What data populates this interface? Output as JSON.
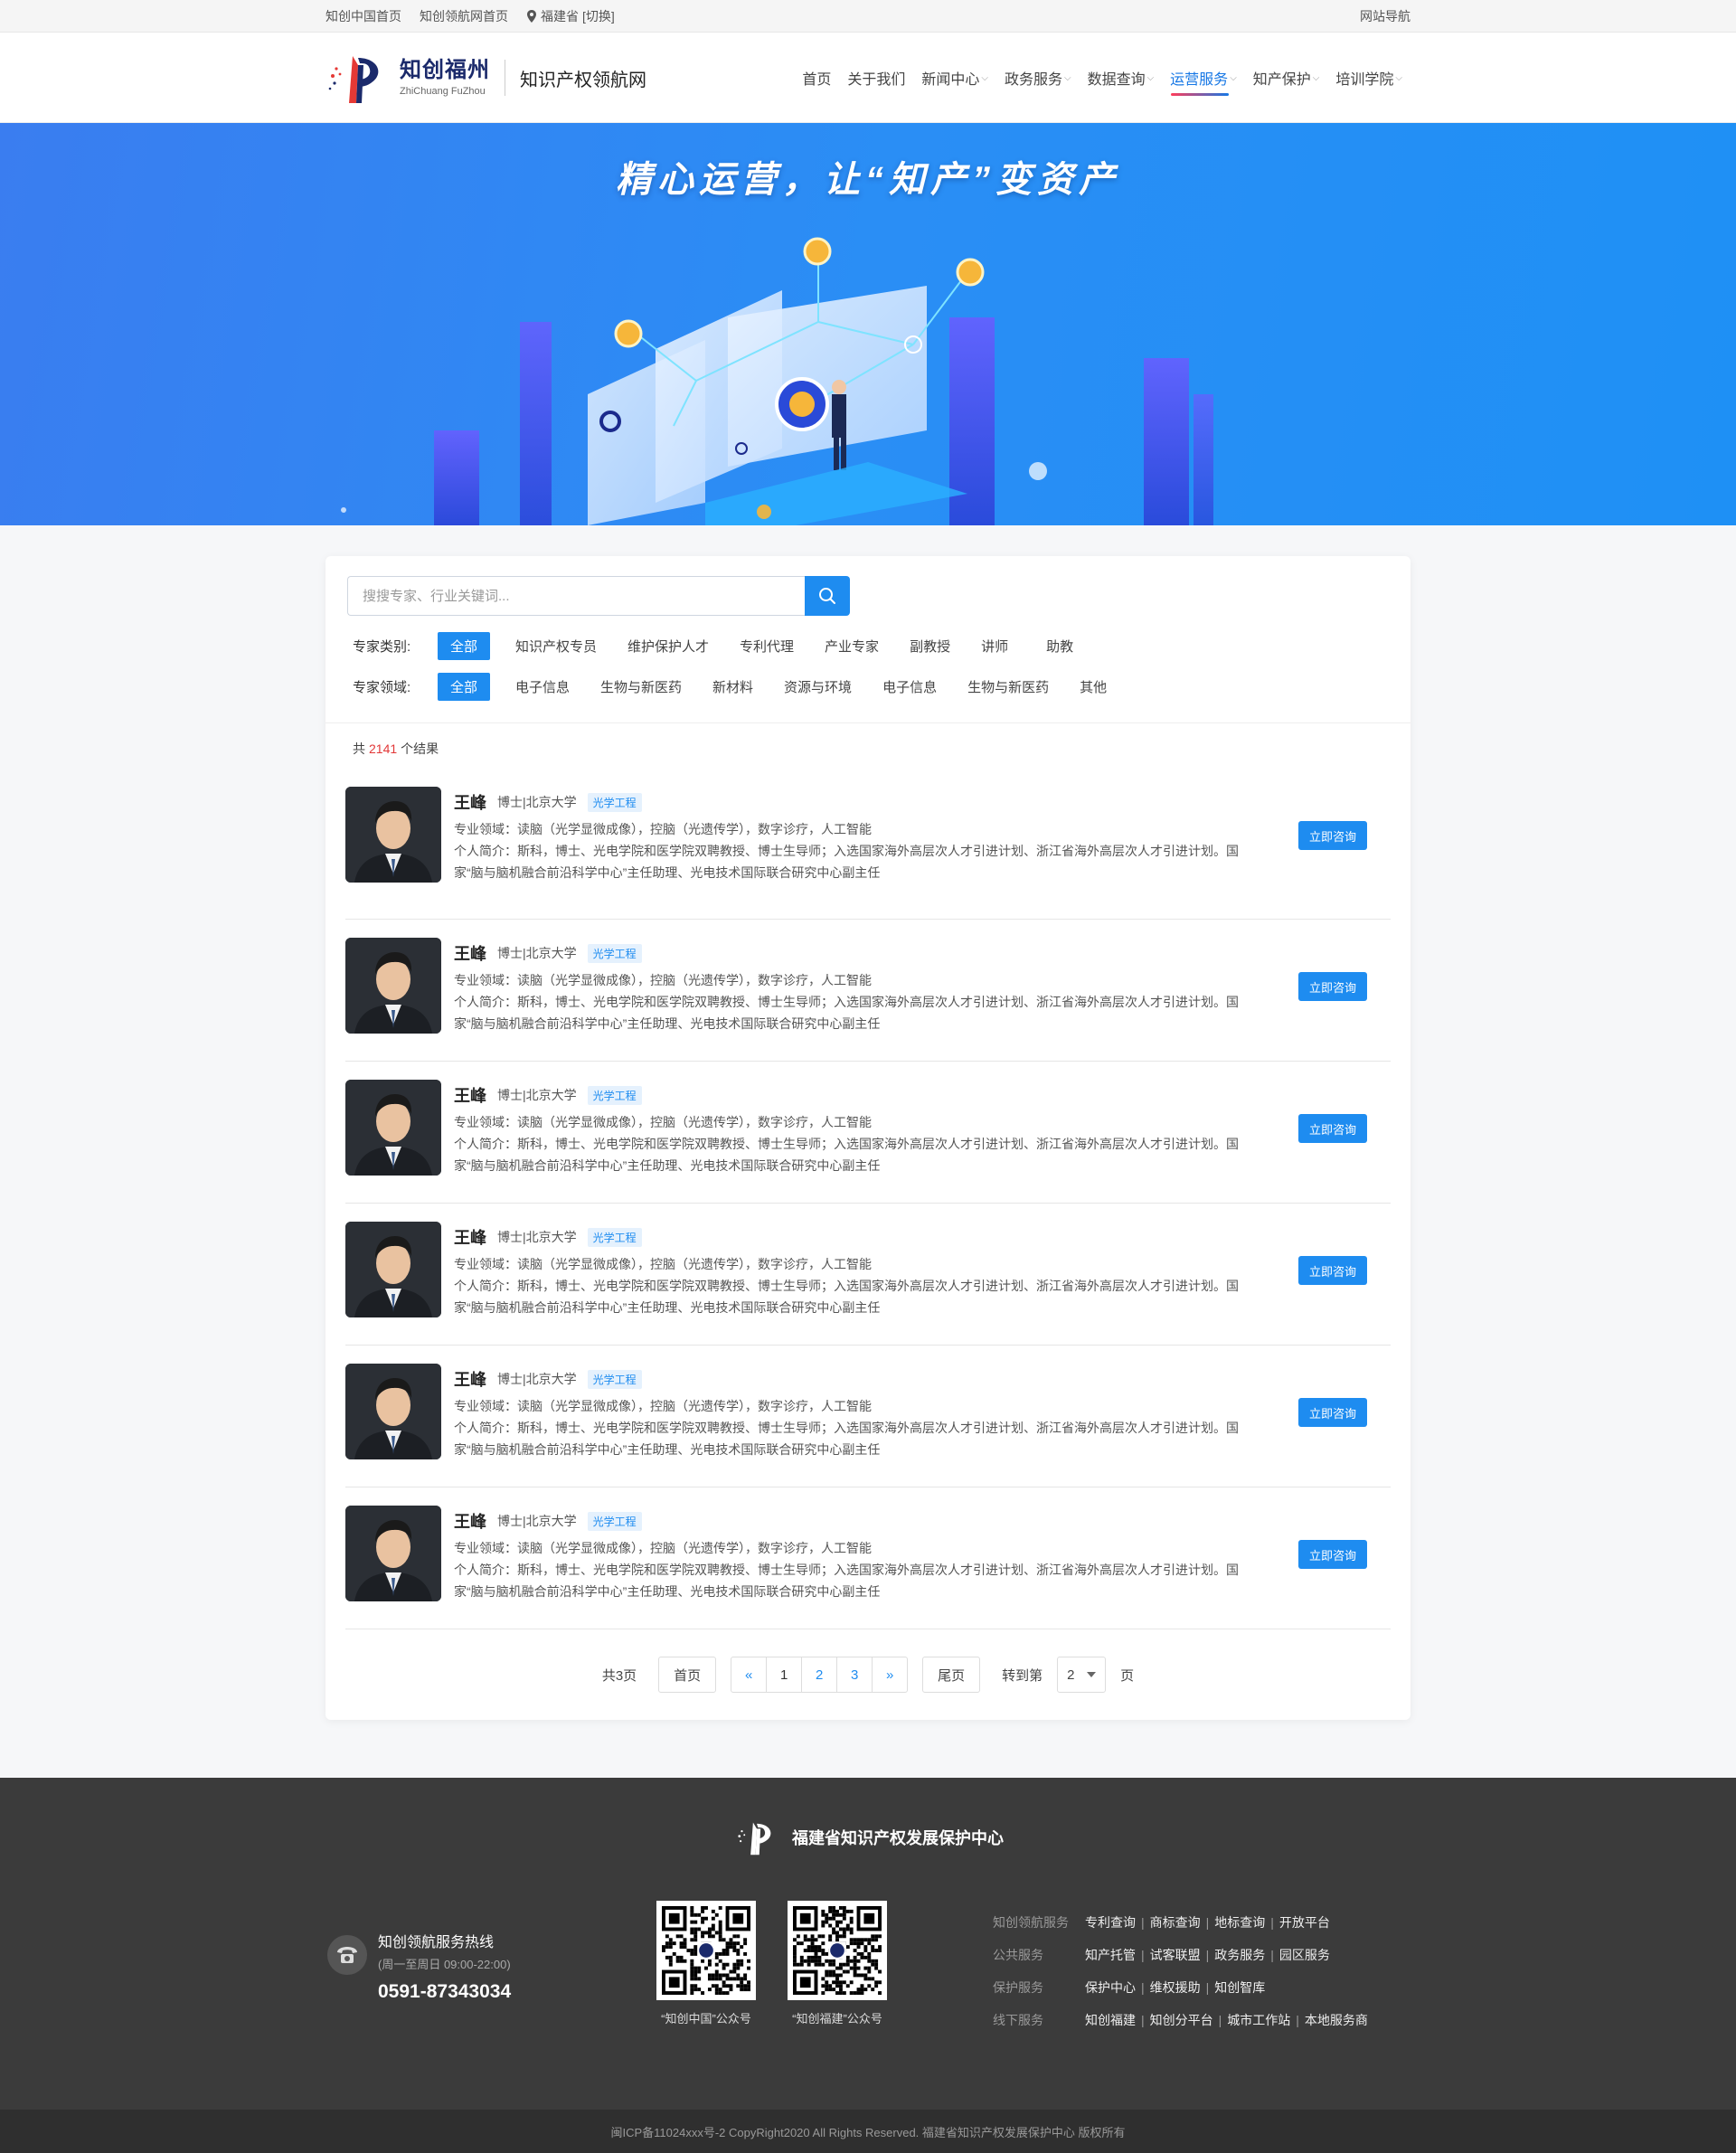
{
  "topbar": {
    "links": [
      "知创中国首页",
      "知创领航网首页"
    ],
    "location": "福建省",
    "switch_label": "[切换]",
    "site_nav": "网站导航"
  },
  "header": {
    "logo_cn": "知创福州",
    "logo_en": "ZhiChuang FuZhou",
    "site_name": "知识产权领航网",
    "nav": [
      {
        "label": "首页",
        "dropdown": false
      },
      {
        "label": "关于我们",
        "dropdown": false
      },
      {
        "label": "新闻中心",
        "dropdown": true
      },
      {
        "label": "政务服务",
        "dropdown": true
      },
      {
        "label": "数据查询",
        "dropdown": true
      },
      {
        "label": "运营服务",
        "dropdown": true,
        "active": true
      },
      {
        "label": "知产保护",
        "dropdown": true
      },
      {
        "label": "培训学院",
        "dropdown": true
      }
    ]
  },
  "banner": {
    "title": "精心运营，让“知产”变资产"
  },
  "search": {
    "placeholder": "搜搜专家、行业关键词..."
  },
  "filters": {
    "category": {
      "label": "专家类别:",
      "options": [
        "全部",
        "知识产权专员",
        "维护保护人才",
        "专利代理",
        "产业专家",
        "副教授",
        "讲师",
        "助教"
      ]
    },
    "field": {
      "label": "专家领域:",
      "options": [
        "全部",
        "电子信息",
        "生物与新医药",
        "新材料",
        "资源与环境",
        "电子信息",
        "生物与新医药",
        "其他"
      ]
    }
  },
  "results": {
    "prefix": "共",
    "count": "2141",
    "suffix": "个结果"
  },
  "experts": [
    {
      "name": "王峰",
      "degree": "博士|北京大学",
      "tag": "光学工程",
      "field": "专业领域：读脑（光学显微成像），控脑（光遗传学），数字诊疗，人工智能",
      "bio1": "个人简介：斯科，博士、光电学院和医学院双聘教授、博士生导师；入选国家海外高层次人才引进计划、浙江省海外高层次人才引进计划。国",
      "bio2": "家“脑与脑机融合前沿科学中心”主任助理、光电技术国际联合研究中心副主任",
      "button": "立即咨询"
    },
    {
      "name": "王峰",
      "degree": "博士|北京大学",
      "tag": "光学工程",
      "field": "专业领域：读脑（光学显微成像），控脑（光遗传学），数字诊疗，人工智能",
      "bio1": "个人简介：斯科，博士、光电学院和医学院双聘教授、博士生导师；入选国家海外高层次人才引进计划、浙江省海外高层次人才引进计划。国",
      "bio2": "家“脑与脑机融合前沿科学中心”主任助理、光电技术国际联合研究中心副主任",
      "button": "立即咨询"
    },
    {
      "name": "王峰",
      "degree": "博士|北京大学",
      "tag": "光学工程",
      "field": "专业领域：读脑（光学显微成像），控脑（光遗传学），数字诊疗，人工智能",
      "bio1": "个人简介：斯科，博士、光电学院和医学院双聘教授、博士生导师；入选国家海外高层次人才引进计划、浙江省海外高层次人才引进计划。国",
      "bio2": "家“脑与脑机融合前沿科学中心”主任助理、光电技术国际联合研究中心副主任",
      "button": "立即咨询"
    },
    {
      "name": "王峰",
      "degree": "博士|北京大学",
      "tag": "光学工程",
      "field": "专业领域：读脑（光学显微成像），控脑（光遗传学），数字诊疗，人工智能",
      "bio1": "个人简介：斯科，博士、光电学院和医学院双聘教授、博士生导师；入选国家海外高层次人才引进计划、浙江省海外高层次人才引进计划。国",
      "bio2": "家“脑与脑机融合前沿科学中心”主任助理、光电技术国际联合研究中心副主任",
      "button": "立即咨询"
    },
    {
      "name": "王峰",
      "degree": "博士|北京大学",
      "tag": "光学工程",
      "field": "专业领域：读脑（光学显微成像），控脑（光遗传学），数字诊疗，人工智能",
      "bio1": "个人简介：斯科，博士、光电学院和医学院双聘教授、博士生导师；入选国家海外高层次人才引进计划、浙江省海外高层次人才引进计划。国",
      "bio2": "家“脑与脑机融合前沿科学中心”主任助理、光电技术国际联合研究中心副主任",
      "button": "立即咨询"
    },
    {
      "name": "王峰",
      "degree": "博士|北京大学",
      "tag": "光学工程",
      "field": "专业领域：读脑（光学显微成像），控脑（光遗传学），数字诊疗，人工智能",
      "bio1": "个人简介：斯科，博士、光电学院和医学院双聘教授、博士生导师；入选国家海外高层次人才引进计划、浙江省海外高层次人才引进计划。国",
      "bio2": "家“脑与脑机融合前沿科学中心”主任助理、光电技术国际联合研究中心副主任",
      "button": "立即咨询"
    }
  ],
  "pagination": {
    "total_pages": "共3页",
    "first": "首页",
    "prev": "«",
    "pages": [
      "1",
      "2",
      "3"
    ],
    "current": "1",
    "next": "»",
    "last": "尾页",
    "goto_prefix": "转到第",
    "goto_value": "2",
    "goto_suffix": "页"
  },
  "footer": {
    "org": "福建省知识产权发展保护中心",
    "hotline_title": "知创领航服务热线",
    "hotline_hours": "(周一至周日 09:00-22:00)",
    "hotline_phone": "0591-87343034",
    "qr": [
      "“知创中国”公众号",
      "“知创福建”公众号"
    ],
    "links": [
      {
        "label": "知创领航服务",
        "items": [
          "专利查询",
          "商标查询",
          "地标查询",
          "开放平台"
        ]
      },
      {
        "label": "公共服务",
        "items": [
          "知产托管",
          "试客联盟",
          "政务服务",
          "园区服务"
        ]
      },
      {
        "label": "保护服务",
        "items": [
          "保护中心",
          "维权援助",
          "知创智库"
        ]
      },
      {
        "label": "线下服务",
        "items": [
          "知创福建",
          "知创分平台",
          "城市工作站",
          "本地服务商"
        ]
      }
    ],
    "copyright": "闽ICP备11024xxx号-2  CopyRight2020  All Rights Reserved.  福建省知识产权发展保护中心  版权所有"
  },
  "colors": {
    "accent": "#1e8cf0",
    "count_red": "#e23838",
    "footer_bg": "#3b3b3b"
  }
}
